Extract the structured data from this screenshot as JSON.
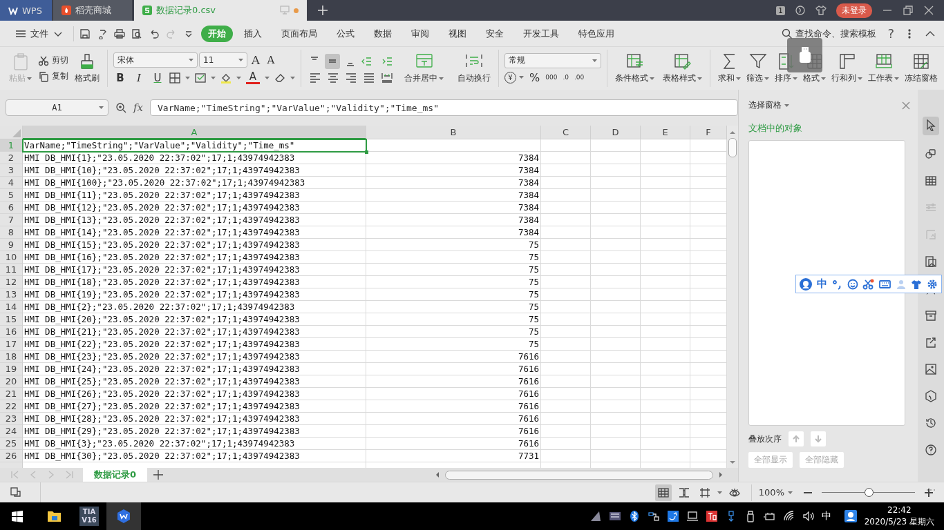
{
  "tabs": [
    {
      "label": "WPS",
      "selected": false,
      "kind": "home"
    },
    {
      "label": "稻壳商城",
      "selected": false,
      "kind": "store"
    },
    {
      "label": "数据记录0.csv",
      "selected": true,
      "kind": "sheet",
      "unsaved": true
    }
  ],
  "title_bar": {
    "badge": "1",
    "login": "未登录"
  },
  "menu": {
    "file": "文件",
    "items": [
      {
        "label": "开始",
        "selected": true
      },
      {
        "label": "插入",
        "selected": false
      },
      {
        "label": "页面布局",
        "selected": false
      },
      {
        "label": "公式",
        "selected": false
      },
      {
        "label": "数据",
        "selected": false
      },
      {
        "label": "审阅",
        "selected": false
      },
      {
        "label": "视图",
        "selected": false
      },
      {
        "label": "安全",
        "selected": false
      },
      {
        "label": "开发工具",
        "selected": false
      },
      {
        "label": "特色应用",
        "selected": false
      }
    ],
    "search": "查找命令、搜索模板",
    "help": "?"
  },
  "ribbon": {
    "paste": {
      "label": "粘贴",
      "disabled": true
    },
    "cut": "剪切",
    "copy": "复制",
    "format_painter": "格式刷",
    "font": "宋体",
    "font_size": "11",
    "bold": "B",
    "italic": "I",
    "underline": "U",
    "grow_font": "A",
    "shrink_font": "A",
    "font_color": "A",
    "vertical_align": [
      {
        "selected": false
      },
      {
        "selected": true
      },
      {
        "selected": false
      }
    ],
    "merge": "合并居中",
    "wrap": "自动换行",
    "number_format": "常规",
    "currency": "¥",
    "percent": "%",
    "thousands": "000",
    "decimals": [
      ".0",
      ".00"
    ],
    "commands": [
      {
        "label": "条件格式",
        "kind": "conditional"
      },
      {
        "label": "表格样式",
        "kind": "table-style"
      },
      {
        "label": "求和",
        "kind": "sum"
      },
      {
        "label": "筛选",
        "kind": "filter"
      },
      {
        "label": "排序",
        "kind": "sort"
      },
      {
        "label": "格式",
        "kind": "format"
      },
      {
        "label": "行和列",
        "kind": "rowcol"
      },
      {
        "label": "工作表",
        "kind": "worksheet"
      },
      {
        "label": "冻结窗格",
        "kind": "freeze"
      }
    ]
  },
  "formula_bar": {
    "name_box": "A1",
    "fx": "fx",
    "formula": "VarName;\"TimeString\";\"VarValue\";\"Validity\";\"Time_ms\""
  },
  "sheet": {
    "columns": [
      {
        "label": "A",
        "selected": true
      },
      {
        "label": "B",
        "selected": false
      },
      {
        "label": "C",
        "selected": false
      },
      {
        "label": "D",
        "selected": false
      },
      {
        "label": "E",
        "selected": false
      },
      {
        "label": "F",
        "selected": false
      }
    ],
    "rows": [
      {
        "number": "1",
        "a": "VarName;\"TimeString\";\"VarValue\";\"Validity\";\"Time_ms\"",
        "b": "",
        "selected": true
      },
      {
        "number": "2",
        "a": "HMI DB_HMI{1};\"23.05.2020 22:37:02\";17;1;43974942383",
        "b": "7384",
        "selected": false
      },
      {
        "number": "3",
        "a": "HMI DB_HMI{10};\"23.05.2020 22:37:02\";17;1;43974942383",
        "b": "7384",
        "selected": false
      },
      {
        "number": "4",
        "a": "HMI DB_HMI{100};\"23.05.2020 22:37:02\";17;1;43974942383",
        "b": "7384",
        "selected": false
      },
      {
        "number": "5",
        "a": "HMI DB_HMI{11};\"23.05.2020 22:37:02\";17;1;43974942383",
        "b": "7384",
        "selected": false
      },
      {
        "number": "6",
        "a": "HMI DB_HMI{12};\"23.05.2020 22:37:02\";17;1;43974942383",
        "b": "7384",
        "selected": false
      },
      {
        "number": "7",
        "a": "HMI DB_HMI{13};\"23.05.2020 22:37:02\";17;1;43974942383",
        "b": "7384",
        "selected": false
      },
      {
        "number": "8",
        "a": "HMI DB_HMI{14};\"23.05.2020 22:37:02\";17;1;43974942383",
        "b": "7384",
        "selected": false
      },
      {
        "number": "9",
        "a": "HMI DB_HMI{15};\"23.05.2020 22:37:02\";17;1;43974942383",
        "b": "75",
        "selected": false
      },
      {
        "number": "10",
        "a": "HMI DB_HMI{16};\"23.05.2020 22:37:02\";17;1;43974942383",
        "b": "75",
        "selected": false
      },
      {
        "number": "11",
        "a": "HMI DB_HMI{17};\"23.05.2020 22:37:02\";17;1;43974942383",
        "b": "75",
        "selected": false
      },
      {
        "number": "12",
        "a": "HMI DB_HMI{18};\"23.05.2020 22:37:02\";17;1;43974942383",
        "b": "75",
        "selected": false
      },
      {
        "number": "13",
        "a": "HMI DB_HMI{19};\"23.05.2020 22:37:02\";17;1;43974942383",
        "b": "75",
        "selected": false
      },
      {
        "number": "14",
        "a": "HMI DB_HMI{2};\"23.05.2020 22:37:02\";17;1;43974942383",
        "b": "75",
        "selected": false
      },
      {
        "number": "15",
        "a": "HMI DB_HMI{20};\"23.05.2020 22:37:02\";17;1;43974942383",
        "b": "75",
        "selected": false
      },
      {
        "number": "16",
        "a": "HMI DB_HMI{21};\"23.05.2020 22:37:02\";17;1;43974942383",
        "b": "75",
        "selected": false
      },
      {
        "number": "17",
        "a": "HMI DB_HMI{22};\"23.05.2020 22:37:02\";17;1;43974942383",
        "b": "75",
        "selected": false
      },
      {
        "number": "18",
        "a": "HMI DB_HMI{23};\"23.05.2020 22:37:02\";17;1;43974942383",
        "b": "7616",
        "selected": false
      },
      {
        "number": "19",
        "a": "HMI DB_HMI{24};\"23.05.2020 22:37:02\";17;1;43974942383",
        "b": "7616",
        "selected": false
      },
      {
        "number": "20",
        "a": "HMI DB_HMI{25};\"23.05.2020 22:37:02\";17;1;43974942383",
        "b": "7616",
        "selected": false
      },
      {
        "number": "21",
        "a": "HMI DB_HMI{26};\"23.05.2020 22:37:02\";17;1;43974942383",
        "b": "7616",
        "selected": false
      },
      {
        "number": "22",
        "a": "HMI DB_HMI{27};\"23.05.2020 22:37:02\";17;1;43974942383",
        "b": "7616",
        "selected": false
      },
      {
        "number": "23",
        "a": "HMI DB_HMI{28};\"23.05.2020 22:37:02\";17;1;43974942383",
        "b": "7616",
        "selected": false
      },
      {
        "number": "24",
        "a": "HMI DB_HMI{29};\"23.05.2020 22:37:02\";17;1;43974942383",
        "b": "7616",
        "selected": false
      },
      {
        "number": "25",
        "a": "HMI DB_HMI{3};\"23.05.2020 22:37:02\";17;1;43974942383",
        "b": "7616",
        "selected": false
      },
      {
        "number": "26",
        "a": "HMI DB_HMI{30};\"23.05.2020 22:37:02\";17;1;43974942383",
        "b": "7731",
        "selected": false
      }
    ]
  },
  "sheet_tabs": [
    {
      "label": "数据记录0",
      "selected": true
    }
  ],
  "side_panel": {
    "title": "选择窗格",
    "heading": "文档中的对象",
    "order_label": "叠放次序",
    "buttons": [
      {
        "label": "全部显示",
        "disabled": true
      },
      {
        "label": "全部隐藏",
        "disabled": true
      }
    ]
  },
  "ime_bar": {
    "mode": "中"
  },
  "status_bar": {
    "zoom": "100%",
    "zoom_slider": {
      "level": 0.5
    }
  },
  "taskbar": {
    "apps": [
      {
        "kind": "explorer",
        "selected": false
      },
      {
        "kind": "tia",
        "selected": false,
        "line_1": "TIA",
        "line_2": "V16"
      },
      {
        "kind": "wps",
        "selected": true
      }
    ],
    "ime": "中",
    "time": "22:42",
    "date": "2020/5/23 星期六"
  }
}
